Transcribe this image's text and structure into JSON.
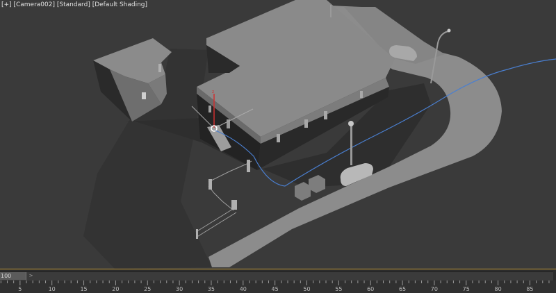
{
  "viewport": {
    "label_parts": [
      "[+]",
      "[Camera002]",
      "[Standard]",
      "[Default Shading]"
    ]
  },
  "timeline": {
    "current_frame": "100",
    "next_button": ">",
    "ticks": [
      "5",
      "10",
      "15",
      "20",
      "25",
      "30",
      "35",
      "40",
      "45",
      "50",
      "55",
      "60",
      "65",
      "70",
      "75",
      "80",
      "85"
    ]
  },
  "colors": {
    "viewport_bg": "#3a3a3a",
    "road": "#8c8c8c",
    "building_roof": "#8a8a8a",
    "building_wall_dark": "#2a2a2a",
    "spline_path": "#4a7fd0",
    "timeline_accent": "#c8a040"
  }
}
